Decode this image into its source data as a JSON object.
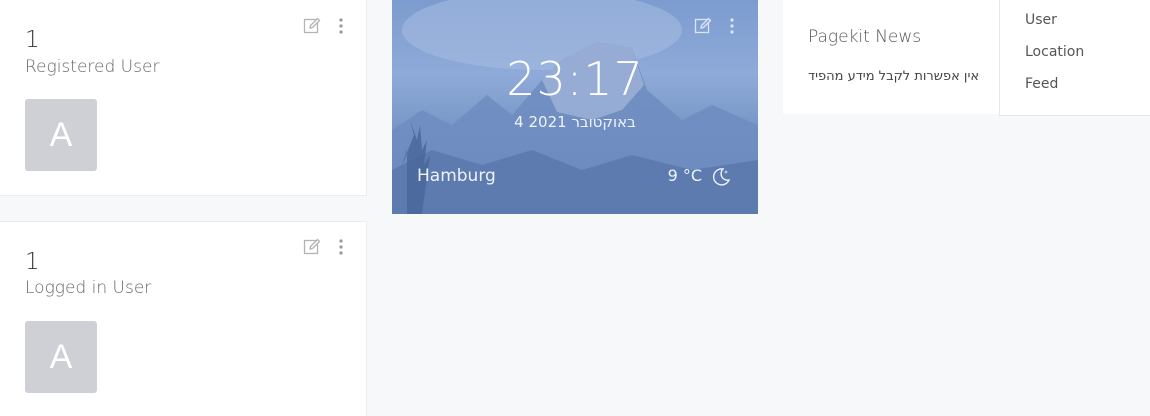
{
  "registered_card": {
    "count": "1",
    "label": "Registered User",
    "avatar_letter": "A"
  },
  "logged_in_card": {
    "count": "1",
    "label": "Logged in User",
    "avatar_letter": "A"
  },
  "weather": {
    "time": "23:17",
    "date": "4 באוקטובר 2021",
    "city": "Hamburg",
    "temperature": "9 °C",
    "condition_icon": "moon-icon"
  },
  "news": {
    "title": "Pagekit News",
    "message": "אין אפשרות לקבל מידע מהפיד"
  },
  "menu": {
    "items": [
      "User",
      "Location",
      "Feed"
    ]
  },
  "colors": {
    "avatar_bg": "#cfd0d5",
    "weather_bg": "#7c9ccf",
    "page_bg": "#f7f8fa"
  }
}
